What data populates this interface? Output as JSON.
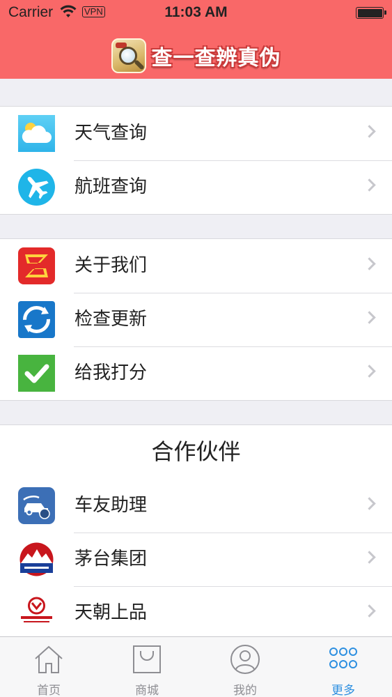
{
  "status_bar": {
    "carrier": "Carrier",
    "vpn": "VPN",
    "time": "11:03 AM",
    "battery_level": 1.0
  },
  "nav": {
    "title": "查一查辨真伪",
    "logo_icon": "magnifier-app-logo",
    "background_color": "#f96868"
  },
  "groups": [
    {
      "rows": [
        {
          "label": "天气查询",
          "icon": "weather-cloud-icon"
        },
        {
          "label": "航班查询",
          "icon": "airplane-icon"
        }
      ]
    },
    {
      "rows": [
        {
          "label": "关于我们",
          "icon": "about-logo-icon"
        },
        {
          "label": "检查更新",
          "icon": "refresh-icon"
        },
        {
          "label": "给我打分",
          "icon": "checkmark-icon"
        }
      ]
    },
    {
      "header": "合作伙伴",
      "rows": [
        {
          "label": "车友助理",
          "icon": "car-assistant-icon"
        },
        {
          "label": "茅台集团",
          "icon": "moutai-logo-icon"
        },
        {
          "label": "天朝上品",
          "icon": "tianchao-logo-icon"
        }
      ]
    }
  ],
  "tabbar": {
    "tabs": [
      {
        "label": "首页",
        "icon": "home-icon",
        "active": false
      },
      {
        "label": "商城",
        "icon": "shopping-bag-icon",
        "active": false
      },
      {
        "label": "我的",
        "icon": "user-icon",
        "active": false
      },
      {
        "label": "更多",
        "icon": "more-grid-icon",
        "active": true
      }
    ],
    "active_color": "#2d8fe0",
    "inactive_color": "#8e8e93"
  }
}
